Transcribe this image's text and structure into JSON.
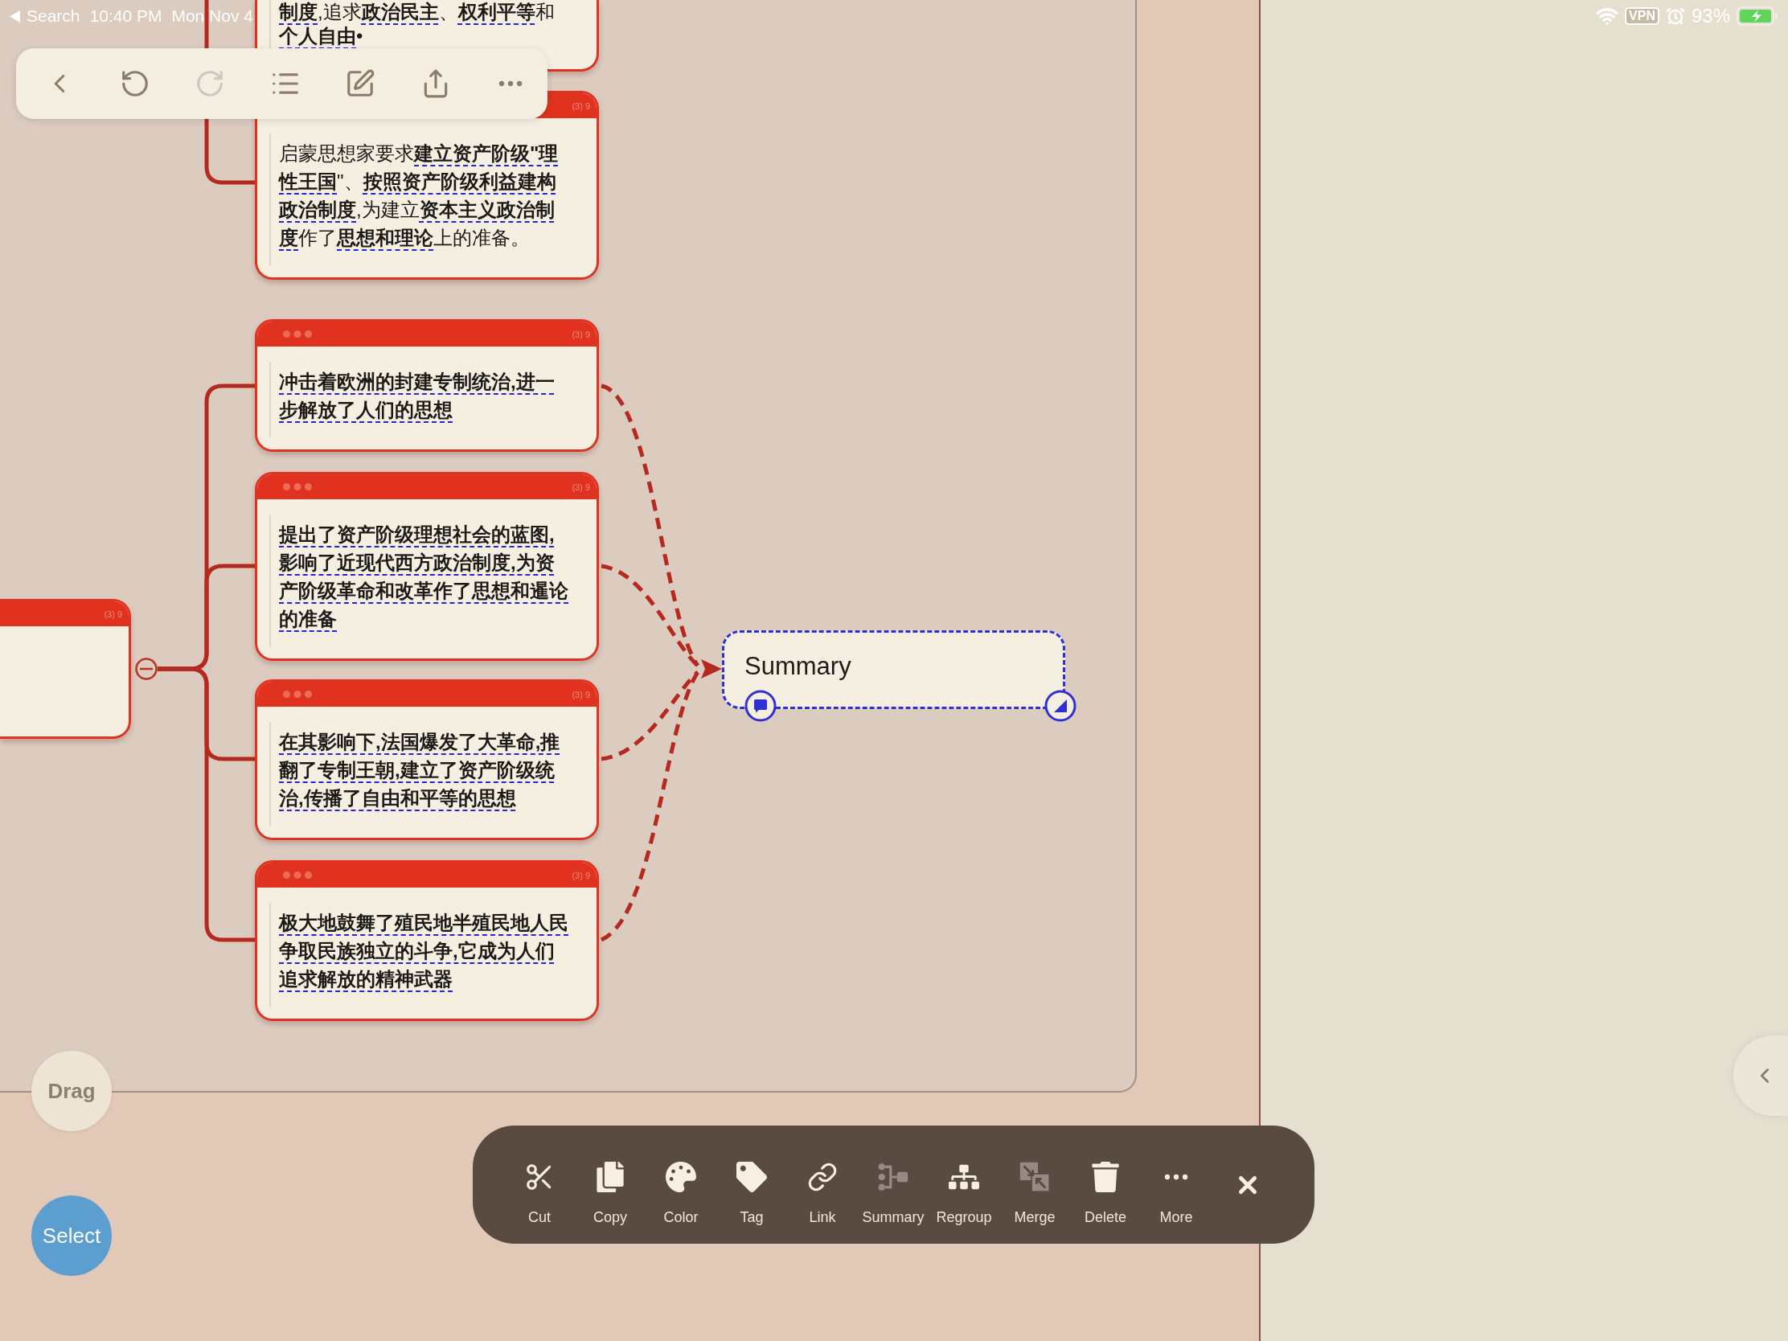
{
  "status_bar": {
    "back_link": "Search",
    "time": "10:40 PM",
    "date": "Mon Nov 4",
    "vpn": "VPN",
    "battery": "93%"
  },
  "top_toolbar": {
    "buttons": [
      {
        "kind": "back",
        "disabled": false
      },
      {
        "kind": "undo",
        "disabled": false
      },
      {
        "kind": "redo",
        "disabled": true
      },
      {
        "kind": "outline",
        "disabled": false
      },
      {
        "kind": "edit",
        "disabled": false
      },
      {
        "kind": "share",
        "disabled": false
      },
      {
        "kind": "more",
        "disabled": false
      }
    ]
  },
  "mind_map": {
    "upper_topics": [
      {
        "text": "**制度**,追求**政治民主**、**权利平等**和**个人自由**•",
        "bold": false,
        "selected": false
      },
      {
        "header": {
          "dots": false,
          "meta": "(3) 9"
        },
        "text": "启蒙思想家要求**建立资产阶级\"理性王国**\"、**按照资产阶级利益建构政治制度**,为建立**资本主义政治制度**作了**思想和理论**上的准备。",
        "bold": false,
        "selected": false
      }
    ],
    "parent_topic": {
      "header": {
        "dots": false,
        "meta": "(3) 9"
      },
      "selected": false,
      "expanded": true,
      "children": [
        {
          "header": {
            "dots": true,
            "meta": "(3) 9"
          },
          "text": "冲击着欧洲的封建专制统治,进一步解放了人们的思想",
          "bold": true,
          "selected": false
        },
        {
          "header": {
            "dots": true,
            "meta": "(3) 9"
          },
          "text": "提出了资产阶级理想社会的蓝图,影响了近现代西方政治制度,为资产阶级革命和改革作了思想和暹论的准备",
          "bold": true,
          "selected": false
        },
        {
          "header": {
            "dots": true,
            "meta": "(3) 9"
          },
          "text": "在其影响下,法国爆发了大革命,推翻了专制王朝,建立了资产阶级统治,传播了自由和平等的思想",
          "bold": true,
          "selected": false
        },
        {
          "header": {
            "dots": true,
            "meta": "(3) 9"
          },
          "text": "极大地鼓舞了殖民地半殖民地人民争取民族独立的斗争,它成为人们追求解放的精神武器",
          "bold": true,
          "selected": false
        }
      ]
    },
    "summary": {
      "label": "Summary",
      "selected": true
    }
  },
  "mode_buttons": [
    {
      "label": "Drag",
      "selected": false
    },
    {
      "label": "Select",
      "selected": true
    }
  ],
  "action_bar": {
    "actions": [
      {
        "kind": "cut",
        "label": "Cut",
        "disabled": false
      },
      {
        "kind": "copy",
        "label": "Copy",
        "disabled": false
      },
      {
        "kind": "color",
        "label": "Color",
        "disabled": false
      },
      {
        "kind": "tag",
        "label": "Tag",
        "disabled": false
      },
      {
        "kind": "link",
        "label": "Link",
        "disabled": false
      },
      {
        "kind": "summary",
        "label": "Summary",
        "disabled": true
      },
      {
        "kind": "regroup",
        "label": "Regroup",
        "disabled": false
      },
      {
        "kind": "merge",
        "label": "Merge",
        "disabled": true
      },
      {
        "kind": "delete",
        "label": "Delete",
        "disabled": false
      },
      {
        "kind": "more",
        "label": "More",
        "disabled": false
      }
    ]
  }
}
